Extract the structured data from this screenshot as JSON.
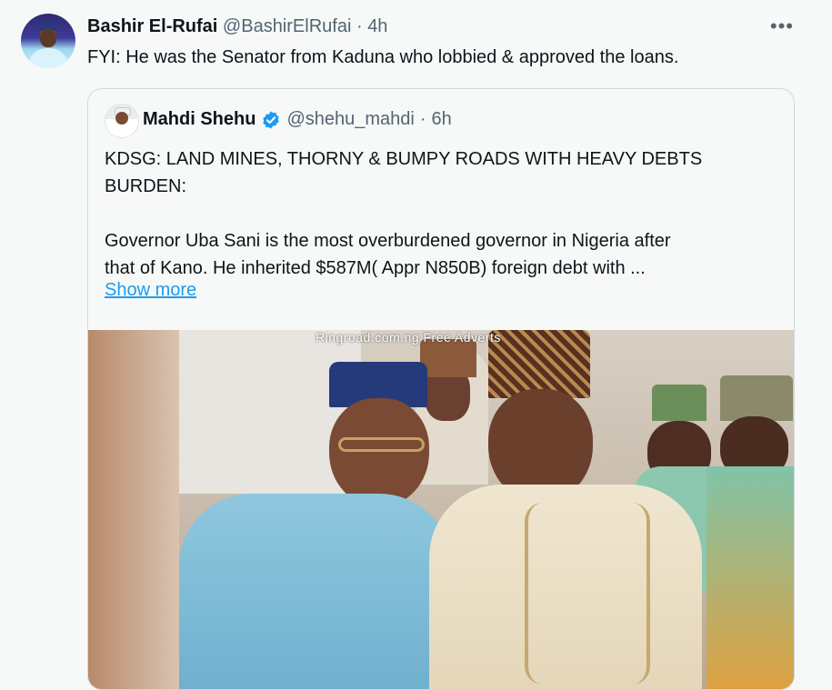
{
  "tweet": {
    "author_name": "Bashir El-Rufai",
    "handle": "@BashirElRufai",
    "separator": "·",
    "time": "4h",
    "more_icon": "more-icon",
    "text": "FYI: He was the Senator from Kaduna who lobbied & approved the loans."
  },
  "quote": {
    "author_name": "Mahdi Shehu",
    "verified_icon": "verified-badge-icon",
    "handle": "@shehu_mahdi",
    "separator": "·",
    "time": "6h",
    "headline_line1": "KDSG: LAND MINES, THORNY & BUMPY ROADS WITH HEAVY  DEBTS",
    "headline_line2": "BURDEN:",
    "body_line1": "Governor Uba Sani is the  most overburdened governor in Nigeria after",
    "body_line2": "that of Kano. He inherited $587M( Appr N850B) foreign debt with ...",
    "show_more": "Show more",
    "image_watermark": "Ringroad.com.ng Free Adverts"
  },
  "colors": {
    "link": "#1d9bf0",
    "muted": "#536471",
    "text": "#0f1419",
    "verified": "#1d9bf0"
  }
}
